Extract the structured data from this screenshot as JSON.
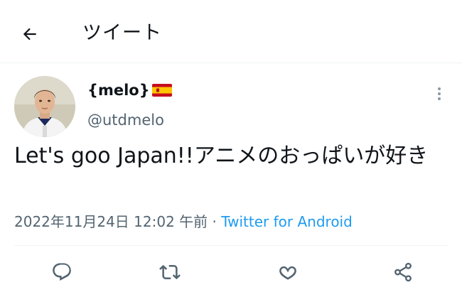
{
  "header": {
    "back_icon": "arrow-left-icon",
    "title": "ツイート"
  },
  "tweet": {
    "display_name": "{melo}",
    "flag_icon": "spain-flag-icon",
    "handle": "@utdmelo",
    "text": "Let's goo Japan!!アニメのおっぱいが好き",
    "timestamp": "2022年11月24日 12:02 午前",
    "separator": " · ",
    "source": "Twitter for Android"
  },
  "actions": [
    {
      "name": "reply",
      "icon": "reply-icon"
    },
    {
      "name": "retweet",
      "icon": "retweet-icon"
    },
    {
      "name": "like",
      "icon": "heart-icon"
    },
    {
      "name": "share",
      "icon": "share-icon"
    }
  ],
  "colors": {
    "text_primary": "#0f1419",
    "text_secondary": "#536471",
    "accent": "#1d9bf0",
    "divider": "#eff3f4"
  }
}
